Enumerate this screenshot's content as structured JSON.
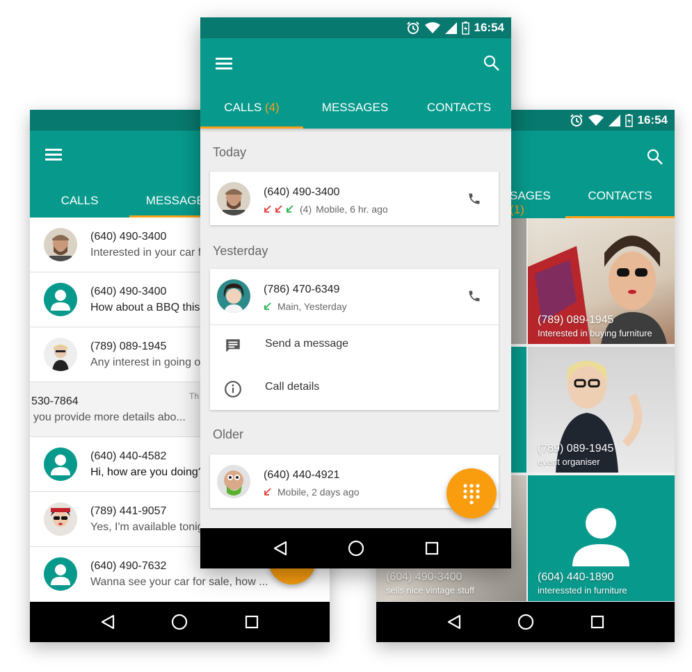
{
  "status_bar": {
    "time": "16:54"
  },
  "left_phone": {
    "tabs": [
      {
        "label": "CALLS"
      },
      {
        "label": "MESSAGES"
      }
    ],
    "messages": [
      {
        "number": "(640) 490-3400",
        "text": "Interested in your car f",
        "avatar": "photo-man-beard"
      },
      {
        "number": "(640) 490-3400",
        "text": "How about a BBQ this",
        "avatar": "contact-icon"
      },
      {
        "number": "(789) 089-1945",
        "text": "Any interest in going o",
        "avatar": "photo-woman-blonde"
      },
      {
        "number": "530-7864",
        "text": "you provide more details abo...",
        "time": "Th",
        "avatar": "none"
      },
      {
        "number": "(640) 440-4582",
        "text": "Hi, how are you doing?",
        "avatar": "contact-icon",
        "unread": true
      },
      {
        "number": "(789) 441-9057",
        "text": "Yes, I'm available tonig",
        "avatar": "photo-woman-sunglasses"
      },
      {
        "number": "(640) 490-7632",
        "text": "Wanna see your car for sale, how ...",
        "avatar": "contact-icon"
      }
    ]
  },
  "center_phone": {
    "tabs": [
      {
        "label": "CALLS",
        "count": "(4)"
      },
      {
        "label": "MESSAGES"
      },
      {
        "label": "CONTACTS"
      }
    ],
    "sections": {
      "today": "Today",
      "yesterday": "Yesterday",
      "older": "Older"
    },
    "calls": [
      {
        "number": "(640) 490-3400",
        "count": "(4)",
        "meta": "Mobile, 6 hr. ago"
      },
      {
        "number": "(786) 470-6349",
        "meta": "Main, Yesterday"
      },
      {
        "number": "(640) 440-4921",
        "meta": "Mobile, 2 days ago"
      }
    ],
    "actions": {
      "send_message": "Send a message",
      "call_details": "Call details"
    }
  },
  "right_phone": {
    "tabs": [
      {
        "label": "SAGES",
        "count": "(1)"
      },
      {
        "label": "CONTACTS"
      }
    ],
    "tiles": [
      {
        "number": "(789) 089-1945",
        "sub": "Interested in buying furniture"
      },
      {
        "number": "(789) 089-1945",
        "sub": "event organiser"
      },
      {
        "number": "(604) 490-3400",
        "sub": "sells nice vintage stuff"
      },
      {
        "number": "(604) 440-1890",
        "sub": "interessted in furniture"
      }
    ]
  },
  "colors": {
    "primary": "#079a8c",
    "primary_dark": "#08796e",
    "accent": "#f99d0e"
  }
}
